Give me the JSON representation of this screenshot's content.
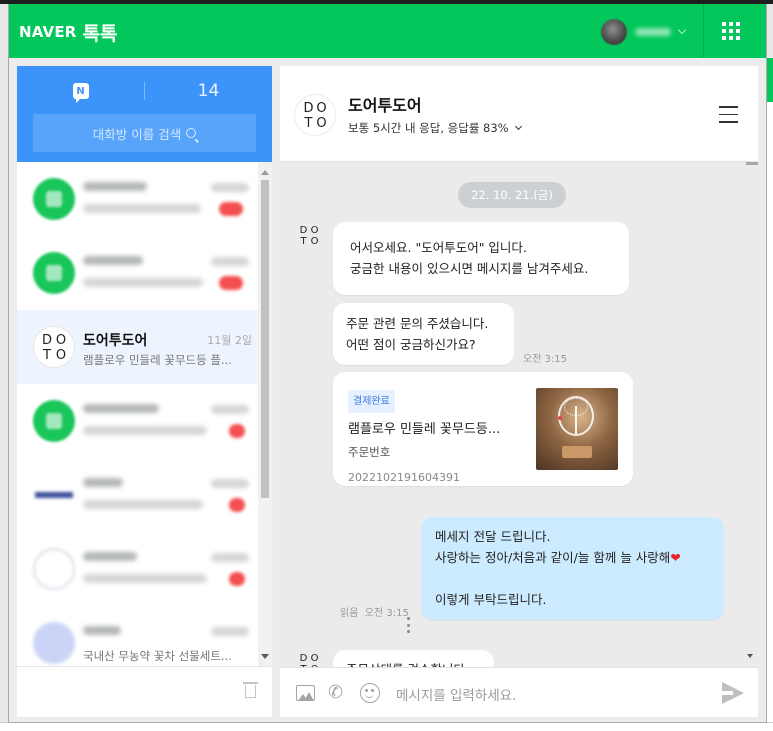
{
  "header": {
    "logo_brand": "NAVER",
    "logo_service": "톡톡"
  },
  "left": {
    "unread_count": "14",
    "search_placeholder": "대화방 이름 검색",
    "selected": {
      "name": "도어투도어",
      "date": "11월 2일",
      "preview": "램플로우 민들레 꽃무드등 플..."
    },
    "last_preview": "국내산 무농약 꽃차 선물세트..."
  },
  "chat": {
    "title": "도어투도어",
    "response_info": "보통 5시간 내 응답, 응답률 83%",
    "date_divider": "22. 10. 21.(금)",
    "messages": [
      {
        "from": "shop",
        "lines": [
          "어서오세요. \"도어투도어\" 입니다.",
          "궁금한 내용이 있으시면 메시지를 남겨주세요."
        ]
      },
      {
        "from": "shop",
        "lines": [
          "주문 관련 문의 주셨습니다.",
          "어떤 점이 궁금하신가요?"
        ],
        "time": "오전 3:15"
      },
      {
        "from": "shop",
        "type": "order_card",
        "badge": "결제완료",
        "product": "램플로우 민들레 꽃무드등...",
        "label": "주문번호",
        "order_no": "2022102191604391"
      },
      {
        "from": "me",
        "lines": [
          "메세지 전달 드립니다.",
          "사랑하는 정아/처음과 같이/늘 함께 늘 사랑해",
          "",
          "이렇게 부탁드립니다."
        ],
        "heart": "❤",
        "read": "읽음",
        "time": "오전 3:15"
      },
      {
        "from": "shop",
        "lines": [
          "주문상태를 검수합니다"
        ]
      }
    ],
    "input_placeholder": "메시지를 입력하세요.",
    "phone_glyph": "✆"
  },
  "logo_letters": [
    "D",
    "O",
    "T",
    "O"
  ],
  "colors": {
    "naver_green": "#03c75a",
    "talk_blue": "#3c94fb",
    "my_bubble": "#ccebff",
    "heart_red": "#e8212a"
  }
}
